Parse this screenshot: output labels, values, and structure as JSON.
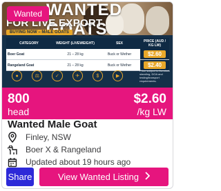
{
  "banner": {
    "headline": "WANTED GOATS",
    "subhead": "FOR LIVE EXPORT",
    "strip": "BUYING NOW – MALE GOATS",
    "table": {
      "headers": [
        "CATEGORY",
        "WEIGHT (LIVEWEIGHT)",
        "SEX",
        "PRICE (AUD / KG LW)"
      ],
      "rows": [
        {
          "category": "Boer Goat",
          "weight": "21 – 28 kg",
          "sex": "Buck or Wether",
          "price": "$2.60"
        },
        {
          "category": "Rangeland Goat",
          "weight": "21 – 28 kg",
          "sex": "Buck or Wether",
          "price": "$2.40"
        }
      ]
    },
    "fine_print": "Price subject to livestock standing, DOA and testing/transport requirements."
  },
  "badge": "Wanted",
  "quantity": {
    "value": "800",
    "unit": "head"
  },
  "price": {
    "value": "$2.60",
    "unit": "/kg LW"
  },
  "listing": {
    "title": "Wanted Male Goat",
    "location": "Finley, NSW",
    "breed": "Boer X & Rangeland",
    "updated": "Updated about 19 hours ago"
  },
  "actions": {
    "share": "Share",
    "view": "View Wanted Listing"
  },
  "colors": {
    "brand_pink": "#e6157e",
    "share_blue": "#2d29d8",
    "navy": "#0f2a44",
    "gold": "#e9a82a"
  }
}
